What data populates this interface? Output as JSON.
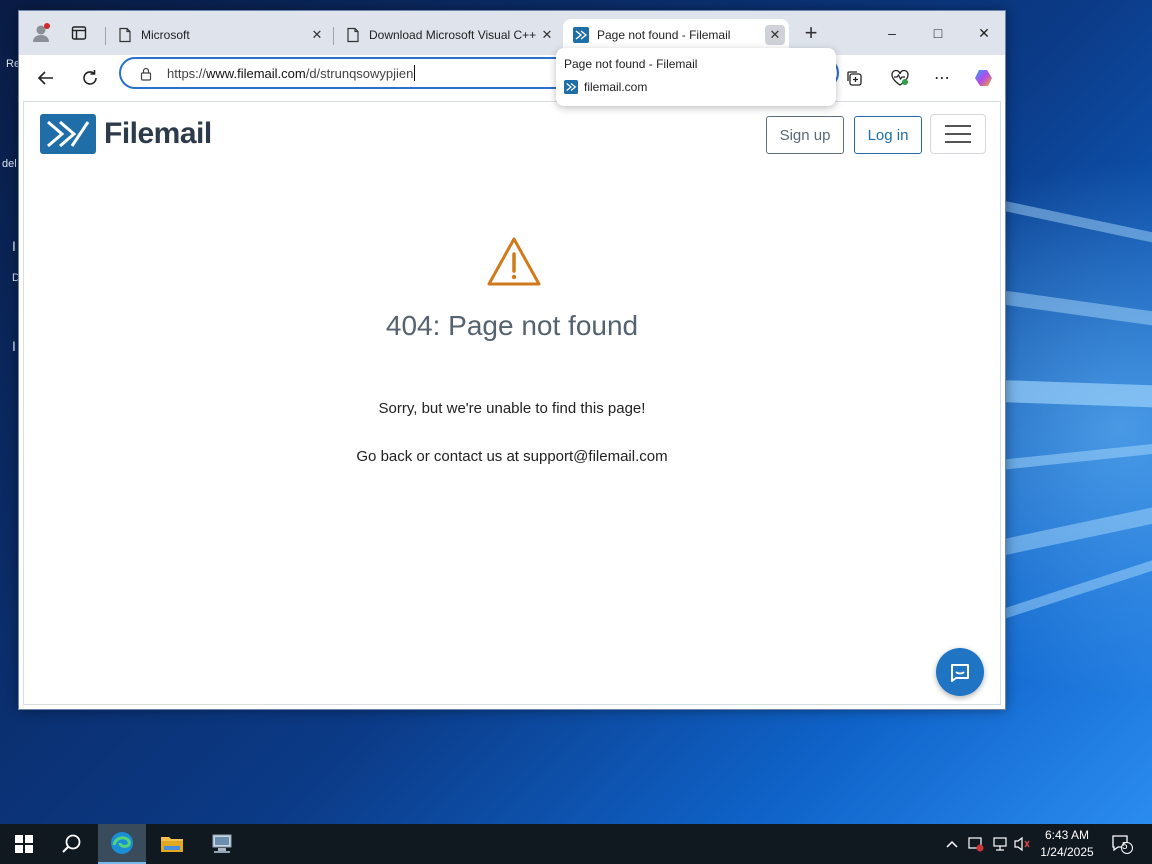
{
  "desktop": {
    "edge_labels": [
      "Re",
      "del",
      "I",
      "D",
      "I"
    ]
  },
  "browser": {
    "tabs": [
      {
        "title": "Microsoft",
        "icon": "page-icon",
        "active": false
      },
      {
        "title": "Download Microsoft Visual C++",
        "icon": "page-icon",
        "active": false
      },
      {
        "title": "Page not found - Filemail",
        "icon": "filemail-favicon",
        "active": true
      }
    ],
    "new_tab": "+",
    "address": {
      "scheme": "https://",
      "host": "www.filemail.com",
      "path": "/d/strunqsowypjien"
    },
    "hover_card": {
      "title": "Page not found - Filemail",
      "domain": "filemail.com"
    },
    "window_controls": {
      "minimize": "–",
      "maximize": "□",
      "close": "✕"
    },
    "more_label": "⋯"
  },
  "page": {
    "logo_text": "Filemail",
    "signup_label": "Sign up",
    "login_label": "Log in",
    "error_title": "404: Page not found",
    "error_message": "Sorry, but we're unable to find this page!",
    "contact_message": "Go back or contact us at support@filemail.com",
    "colors": {
      "brand_blue": "#1f6ea8",
      "warning": "#d07a1c",
      "chat": "#1f74c4"
    }
  },
  "taskbar": {
    "time": "6:43 AM",
    "date": "1/24/2025",
    "notification_count": "5"
  }
}
